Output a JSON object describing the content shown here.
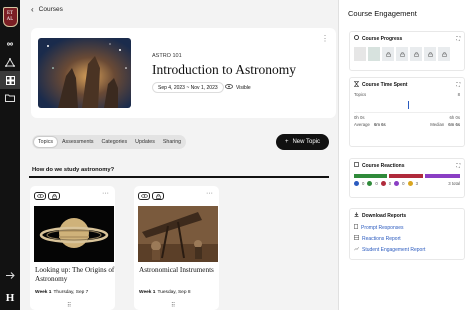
{
  "rail": {
    "logo_text": "ET\nAL",
    "h_label": "H"
  },
  "topbar": {
    "back_label": "Courses"
  },
  "course": {
    "code": "ASTRO 101",
    "title": "Introduction to Astronomy",
    "dates": "Sep 4, 2023 ~ Nov 1, 2023",
    "visibility": "Visible"
  },
  "tabs": [
    "Topics",
    "Assessments",
    "Categories",
    "Updates",
    "Sharing"
  ],
  "new_topic_label": "New Topic",
  "section_title": "How do we study astronomy?",
  "topics": [
    {
      "title": "Looking up: The Origins of Astronomy",
      "week": "Week 1",
      "date": "Thursday, Sep 7"
    },
    {
      "title": "Astronomical Instruments",
      "week": "Week 1",
      "date": "Tuesday, Sep 8"
    }
  ],
  "right": {
    "title": "Course Engagement",
    "progress": {
      "title": "Course Progress"
    },
    "time": {
      "title": "Course Time Spent",
      "topics_label": "Topics",
      "scale_max": "8",
      "ticks": [
        "0h 0s",
        "6h 0s"
      ],
      "average_label": "Average",
      "average_value": "6m 6s",
      "median_label": "Median",
      "median_value": "6m 6s"
    },
    "reactions": {
      "title": "Course Reactions",
      "counts": [
        "0",
        "0",
        "0",
        "0",
        "3"
      ],
      "total": "3 total",
      "colors": [
        "#2f8a3a",
        "#b02a3b",
        "#8a3ec4"
      ]
    },
    "reports": {
      "title": "Download Reports",
      "links": [
        "Prompt Responses",
        "Reactions Report",
        "Student Engagement Report"
      ]
    }
  },
  "colors": {
    "accent": "#111111",
    "link": "#2b5bbf"
  }
}
